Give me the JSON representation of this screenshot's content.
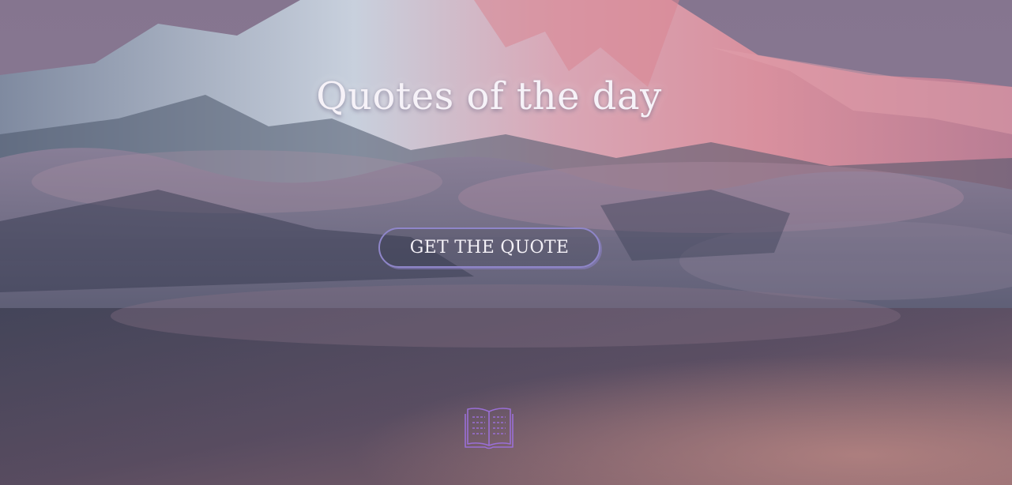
{
  "page": {
    "title": "Quotes of the day",
    "cta_label": "GET THE QUOTE"
  },
  "icons": {
    "book": "open-book-icon"
  },
  "colors": {
    "title_text": "#f6f2f8",
    "button_border": "#8f86c9",
    "icon_stroke": "#9a6fd6"
  }
}
